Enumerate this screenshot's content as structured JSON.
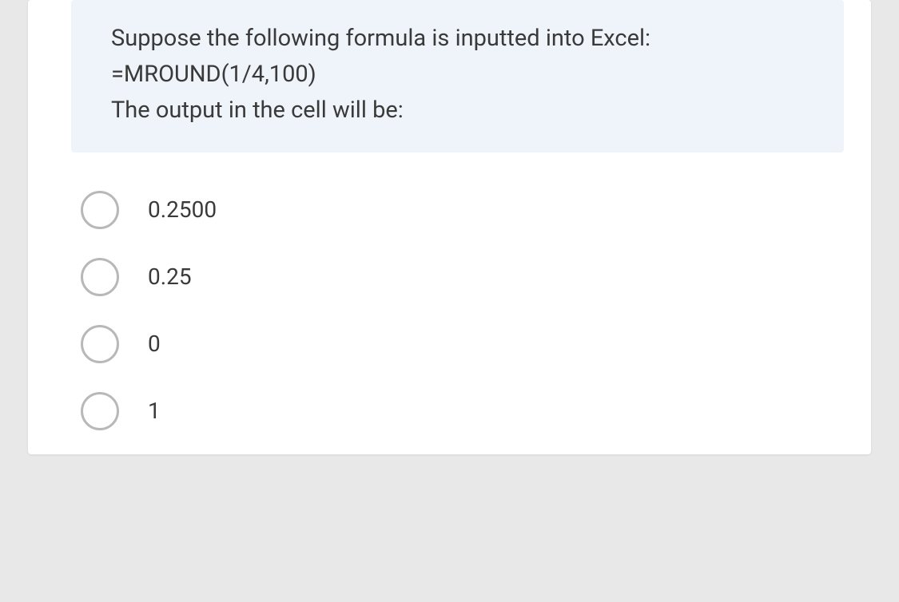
{
  "question": {
    "line1": "Suppose the following formula is inputted into Excel:",
    "line2": "=MROUND(1/4,100)",
    "line3": "The output in the cell will be:"
  },
  "options": [
    {
      "label": "0.2500"
    },
    {
      "label": "0.25"
    },
    {
      "label": "0"
    },
    {
      "label": "1"
    }
  ]
}
